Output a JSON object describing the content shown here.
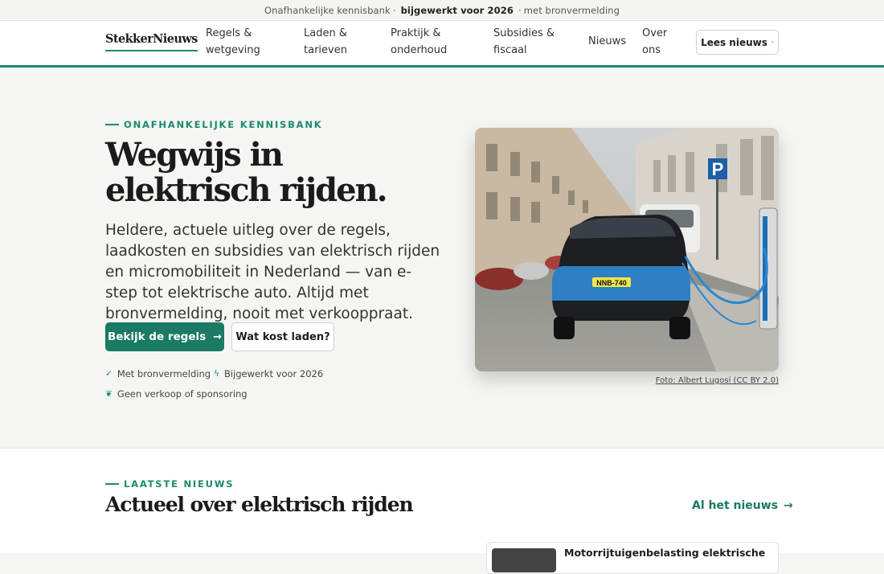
{
  "topbar": {
    "part1": "Onafhankelijke kennisbank",
    "sep": "·",
    "part2": "bijgewerkt voor 2026",
    "part3": "met bronvermelding"
  },
  "header": {
    "logo": "StekkerNieuws",
    "nav": [
      {
        "line1": "Regels &",
        "line2": "wetgeving"
      },
      {
        "line1": "Laden &",
        "line2": "tarieven"
      },
      {
        "line1": "Praktijk &",
        "line2": "onderhoud"
      },
      {
        "line1": "Subsidies &",
        "line2": "fiscaal"
      },
      {
        "line1": "Nieuws",
        "line2": ""
      },
      {
        "line1": "Over",
        "line2": "ons"
      }
    ],
    "cta": "Lees nieuws",
    "cta_dot": "·"
  },
  "hero": {
    "eyebrow": "ONAFHANKELIJKE KENNISBANK",
    "title_line1": "Wegwijs in",
    "title_line2": "elektrisch rijden.",
    "lead": "Heldere, actuele uitleg over de regels, laadkosten en subsidies van elektrisch rijden en micromobiliteit in Nederland — van e-step tot elektrische auto. Altijd met bronvermelding, nooit met verkooppraat.",
    "btn_primary": "Bekijk de regels",
    "btn_primary_icon": "arrow-right-icon",
    "btn_secondary": "Wat kost laden?",
    "trust": [
      {
        "icon": "check-icon",
        "glyph": "✓",
        "text": "Met bronvermelding"
      },
      {
        "icon": "bolt-icon",
        "glyph": "ϟ",
        "text": "Bijgewerkt voor 2026"
      },
      {
        "icon": "leaf-icon",
        "glyph": "❦",
        "text": "Geen verkoop of sponsoring"
      }
    ],
    "plate": "NNB-740",
    "photo_credit": "Foto: Albert Lugosi (CC BY 2.0)"
  },
  "news": {
    "eyebrow": "LAATSTE NIEUWS",
    "title": "Actueel over elektrisch rijden",
    "all_link": "Al het nieuws",
    "first_card_title": "Motorrijtuigenbelasting elektrische"
  },
  "colors": {
    "accent": "#1a8a6e",
    "button": "#1a7a63",
    "page_bg": "#f5f5f3"
  },
  "glyphs": {
    "arrow": "→"
  }
}
